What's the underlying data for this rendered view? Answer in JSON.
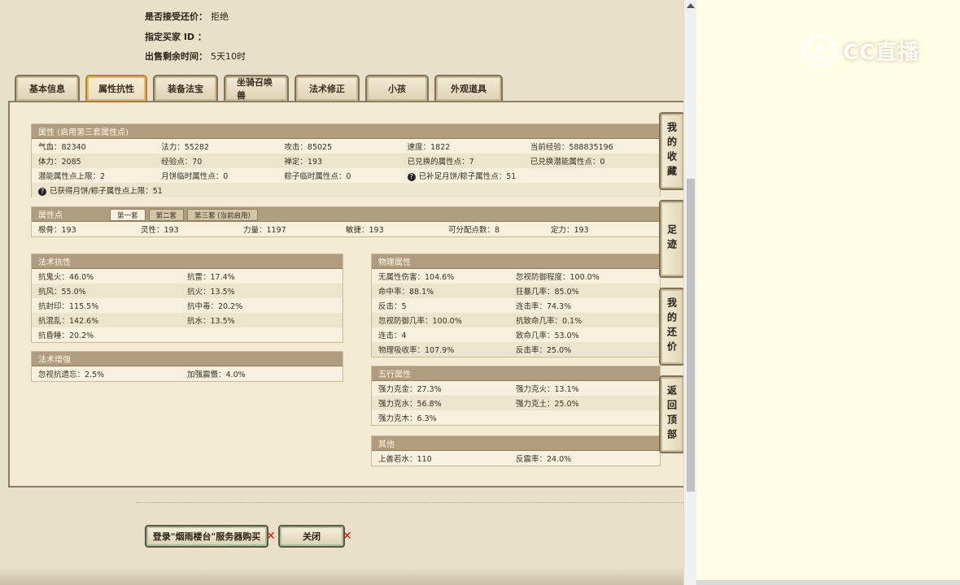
{
  "info": [
    {
      "label": "是否接受还价：",
      "value": "拒绝"
    },
    {
      "label": "指定买家 ID ：",
      "value": ""
    },
    {
      "label": "出售剩余时间：",
      "value": "5天10时"
    }
  ],
  "tabs": [
    "基本信息",
    "属性抗性",
    "装备法宝",
    "坐骑召唤兽",
    "法术修正",
    "小孩",
    "外观道具"
  ],
  "active_tab": "属性抗性",
  "attr_section": {
    "title": "属性 (启用第三套属性点)",
    "rows": [
      [
        "气血：82340",
        "法力：55282",
        "攻击：85025",
        "速度：1822",
        "当前经验：588835196"
      ],
      [
        "体力：2085",
        "经验点：70",
        "禅定：193",
        "已兑换的属性点：7",
        "已兑换潜能属性点：0"
      ],
      [
        "潜能属性点上限：2",
        "月饼临时属性点：0",
        "粽子临时属性点：0",
        "已补足月饼/粽子属性点：51",
        ""
      ],
      [
        "已获得月饼/粽子属性点上限：51"
      ]
    ]
  },
  "points_section": {
    "title": "属性点",
    "subtabs": [
      "第一套",
      "第二套",
      "第三套 (当前启用)"
    ],
    "row": [
      "根骨：193",
      "灵性：193",
      "力量：1197",
      "敏捷：193",
      "可分配点数：8",
      "定力：193"
    ]
  },
  "magic_resist": {
    "title": "法术抗性",
    "rows": [
      [
        "抗鬼火：46.0%",
        "抗雷：17.4%"
      ],
      [
        "抗风：55.0%",
        "抗火：13.5%"
      ],
      [
        "抗封印：115.5%",
        "抗中毒：20.2%"
      ],
      [
        "抗混乱：142.6%",
        "抗水：13.5%"
      ],
      [
        "抗昏睡：20.2%",
        ""
      ]
    ]
  },
  "magic_boost": {
    "title": "法术增强",
    "rows": [
      [
        "忽视抗遗忘：2.5%",
        "加强震慑：4.0%"
      ]
    ]
  },
  "physical": {
    "title": "物理属性",
    "rows": [
      [
        "无属性伤害：104.6%",
        "忽视防御程度：100.0%"
      ],
      [
        "命中率：88.1%",
        "狂暴几率：85.0%"
      ],
      [
        "反击：5",
        "连击率：74.3%"
      ],
      [
        "忽视防御几率：100.0%",
        "抗致命几率：0.1%"
      ],
      [
        "连击：4",
        "致命几率：53.0%"
      ],
      [
        "物理吸收率：107.9%",
        "反击率：25.0%"
      ]
    ]
  },
  "five_elements": {
    "title": "五行属性",
    "rows": [
      [
        "强力克金：27.3%",
        "强力克火：13.1%"
      ],
      [
        "强力克水：56.8%",
        "强力克土：25.0%"
      ],
      [
        "强力克木：6.3%",
        ""
      ]
    ]
  },
  "other": {
    "title": "其他",
    "rows": [
      [
        "上善若水：110",
        "反震率：24.0%"
      ]
    ]
  },
  "side_tabs": [
    "我的收藏",
    "足迹",
    "我的还价",
    "返回顶部"
  ],
  "buttons": {
    "login_buy": "登录\"烟雨楼台\"服务器购买",
    "close": "关闭"
  },
  "watermark": "CC直播",
  "question_icon": "?",
  "close_mark": "✕"
}
